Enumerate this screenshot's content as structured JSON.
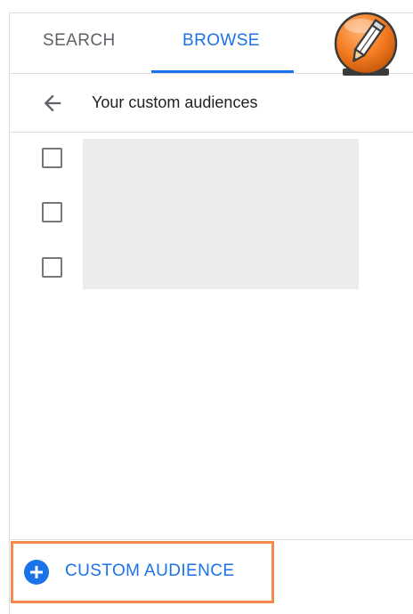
{
  "tabs": [
    {
      "label": "SEARCH",
      "active": false
    },
    {
      "label": "BROWSE",
      "active": true
    }
  ],
  "logo": {
    "icon": "pencil-icon",
    "color": "#f47b20"
  },
  "header": {
    "title": "Your custom audiences",
    "back_icon": "arrow-left-icon"
  },
  "list": {
    "checkbox_count": 3,
    "checked": [
      false,
      false,
      false
    ]
  },
  "footer": {
    "add_button_label": "CUSTOM AUDIENCE",
    "add_icon": "plus-circle-icon"
  },
  "colors": {
    "accent": "#1a73e8",
    "highlight_border": "#f28b4b",
    "placeholder": "#ececec"
  }
}
